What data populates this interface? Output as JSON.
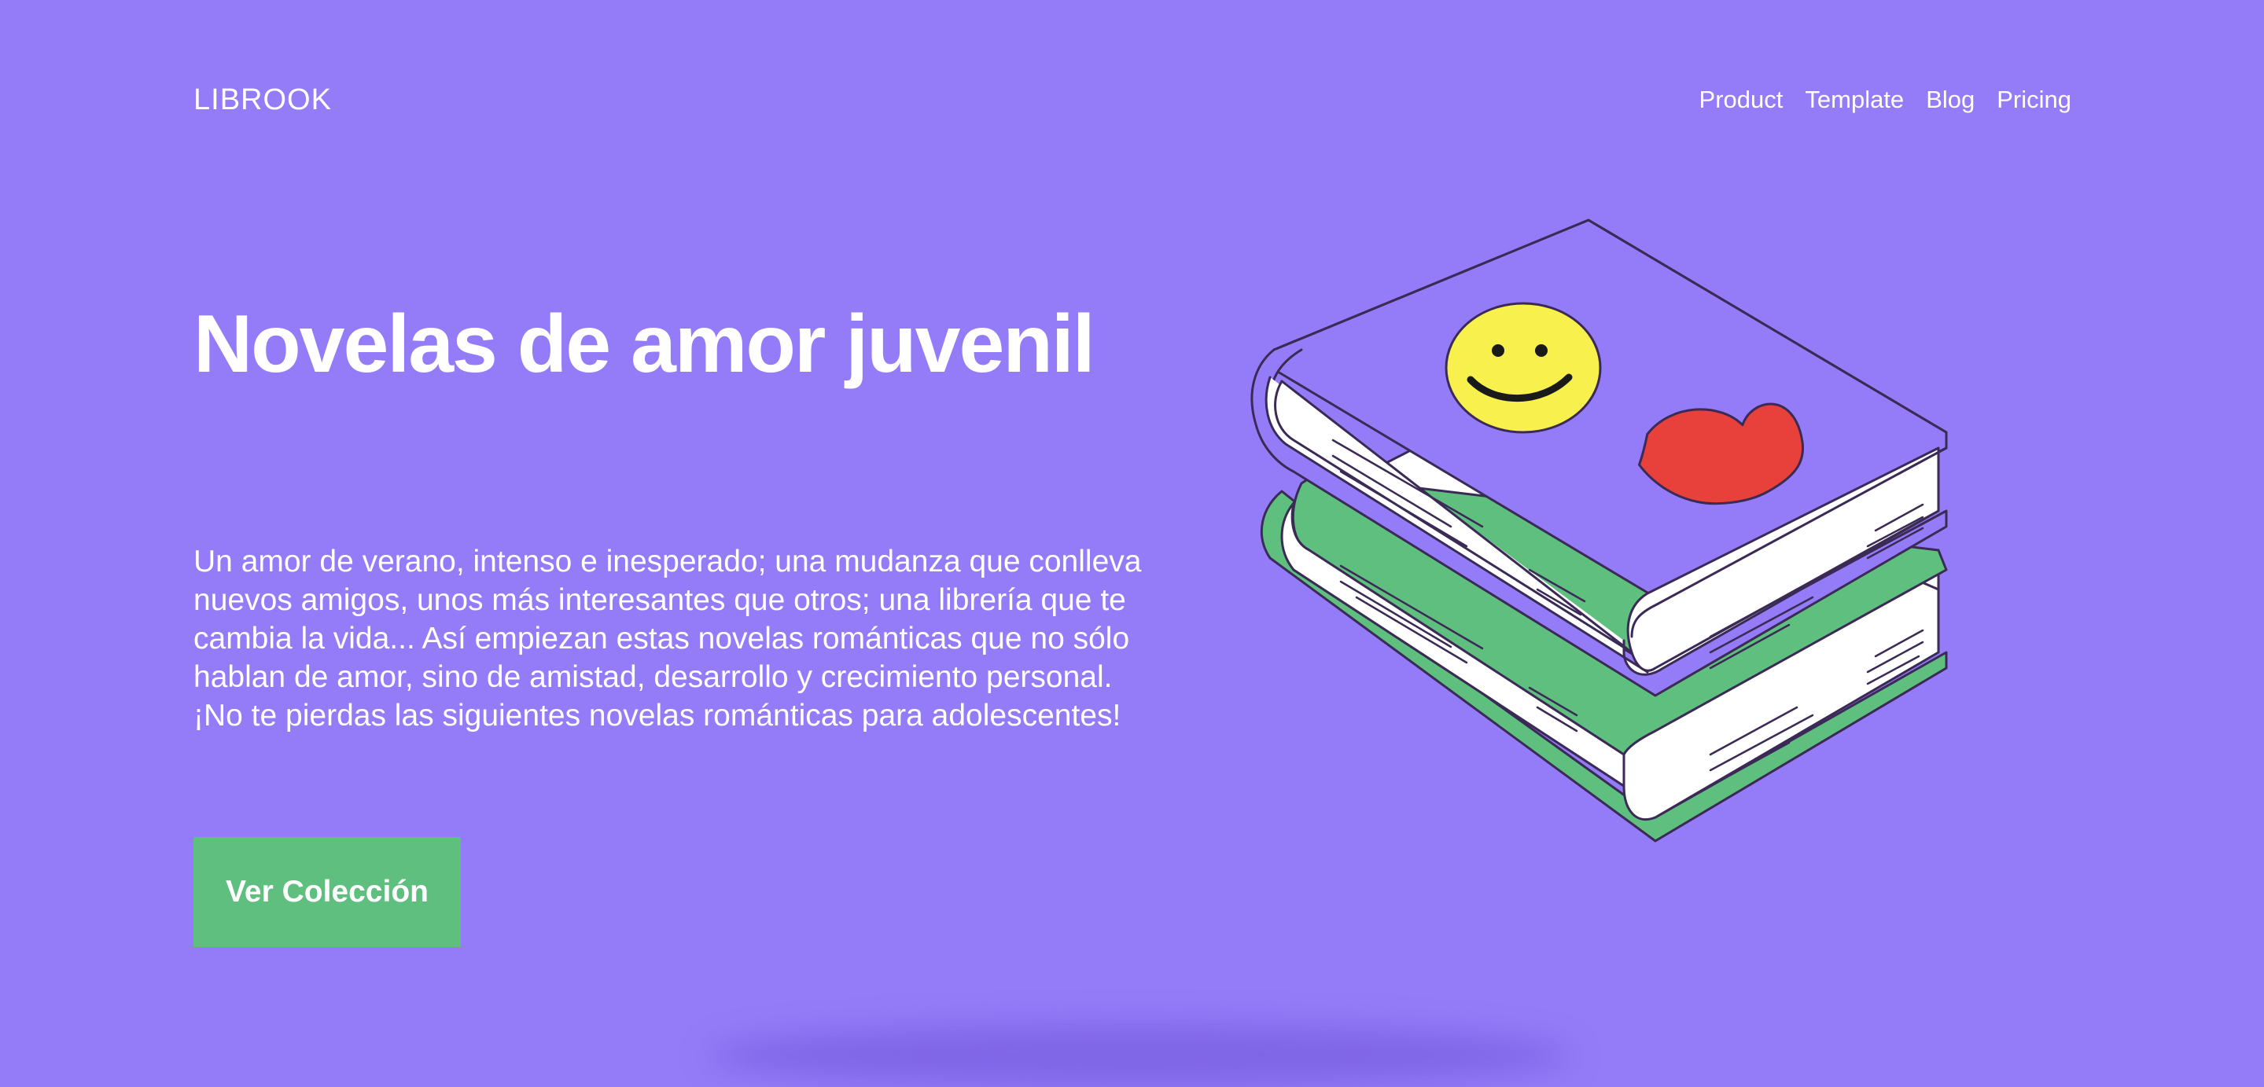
{
  "header": {
    "logo": "LIBROOK",
    "nav": [
      {
        "label": "Product"
      },
      {
        "label": "Template"
      },
      {
        "label": "Blog"
      },
      {
        "label": "Pricing"
      }
    ]
  },
  "hero": {
    "title": "Novelas de amor juvenil",
    "description": "Un amor de verano, intenso e inesperado; una mudanza que conlleva nuevos amigos, unos más interesantes que otros; una librería que te cambia la vida... Así empiezan estas novelas románticas que no sólo hablan de amor, sino de amistad, desarrollo y crecimiento personal. ¡No te pierdas las siguientes novelas románticas para adolescentes!",
    "cta_label": "Ver Colección"
  },
  "illustration": {
    "icon": "stacked-books-illustration",
    "colors": {
      "background": "#947cf8",
      "top_book_cover": "#947cf8",
      "bottom_book_cover": "#5fbf7f",
      "pages": "#ffffff",
      "smiley": "#f8f04c",
      "heart": "#e8403a",
      "outline": "#3a2a55",
      "cta": "#5fbf7f"
    }
  }
}
